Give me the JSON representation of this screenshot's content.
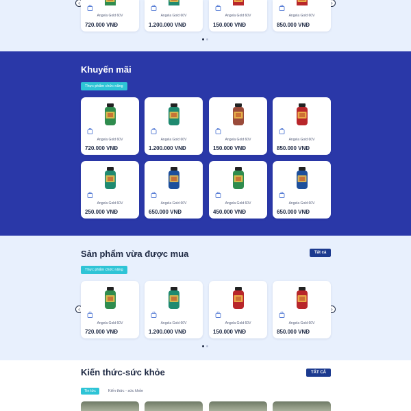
{
  "top_products": [
    {
      "name": "Angela Gold 60V",
      "price": "720.000 VNĐ",
      "bottle": "green"
    },
    {
      "name": "Angela Gold 60V",
      "price": "1.200.000 VNĐ",
      "bottle": "teal"
    },
    {
      "name": "Angela Gold 60V",
      "price": "150.000 VNĐ",
      "bottle": "red"
    },
    {
      "name": "Angela Gold 60V",
      "price": "850.000 VNĐ",
      "bottle": "red"
    }
  ],
  "promo": {
    "title": "Khuyến mãi",
    "tag": "Thực phẩm chức năng",
    "products": [
      {
        "name": "Angela Gold 60V",
        "price": "720.000 VNĐ",
        "bottle": "green"
      },
      {
        "name": "Angela Gold 60V",
        "price": "1.200.000 VNĐ",
        "bottle": "teal"
      },
      {
        "name": "Angela Gold 60V",
        "price": "150.000 VNĐ",
        "bottle": "brown"
      },
      {
        "name": "Angela Gold 60V",
        "price": "850.000 VNĐ",
        "bottle": "red"
      },
      {
        "name": "Angela Gold 60V",
        "price": "250.000 VNĐ",
        "bottle": "teal"
      },
      {
        "name": "Angela Gold 60V",
        "price": "650.000 VNĐ",
        "bottle": "blue"
      },
      {
        "name": "Angela Gold 60V",
        "price": "450.000 VNĐ",
        "bottle": "green"
      },
      {
        "name": "Angela Gold 60V",
        "price": "650.000 VNĐ",
        "bottle": "blue"
      }
    ]
  },
  "recent": {
    "title": "Sản phẩm vừa được mua",
    "all_label": "Tất cả",
    "tag": "Thực phẩm chức năng",
    "products": [
      {
        "name": "Angela Gold 60V",
        "price": "720.000 VNĐ",
        "bottle": "green"
      },
      {
        "name": "Angela Gold 60V",
        "price": "1.200.000 VNĐ",
        "bottle": "teal"
      },
      {
        "name": "Angela Gold 60V",
        "price": "150.000 VNĐ",
        "bottle": "red"
      },
      {
        "name": "Angela Gold 60V",
        "price": "850.000 VNĐ",
        "bottle": "red"
      }
    ]
  },
  "news": {
    "title": "Kiến thức-sức khỏe",
    "all_label": "TẤT CẢ",
    "tabs": [
      "Tin tức",
      "Kiến thức - sức khỏe"
    ]
  },
  "colors": {
    "green": "#2f8c4e",
    "teal": "#1f8a70",
    "red": "#b8262a",
    "brown": "#9a4b3a",
    "blue": "#1d4f9c",
    "accent": "#2ec4d6",
    "brand": "#2a38a8"
  }
}
